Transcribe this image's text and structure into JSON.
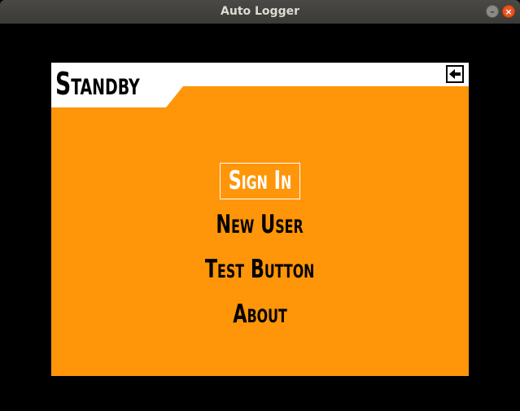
{
  "window": {
    "title": "Auto Logger",
    "minimize_glyph": "–",
    "close_glyph": "×"
  },
  "header": {
    "title": "Standby",
    "back_icon": "arrow-left-icon"
  },
  "menu": {
    "items": [
      {
        "label": "Sign In",
        "selected": true
      },
      {
        "label": "New User",
        "selected": false
      },
      {
        "label": "Test Button",
        "selected": false
      },
      {
        "label": "About",
        "selected": false
      }
    ]
  },
  "colors": {
    "panel": "#ff9509",
    "header": "#ffffff",
    "selected_text": "#ffffff",
    "text": "#000000",
    "background": "#000000"
  }
}
